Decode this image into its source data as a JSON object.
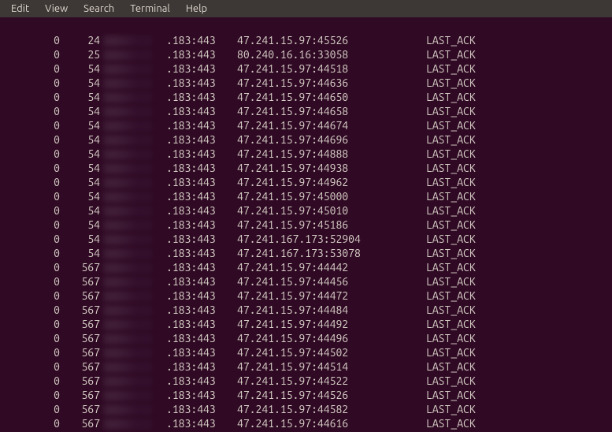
{
  "menubar": {
    "items": [
      "Edit",
      "View",
      "Search",
      "Terminal",
      "Help"
    ]
  },
  "terminal": {
    "rows": [
      {
        "c1": "0",
        "c2": "24",
        "c4": ".183:443",
        "c5": "47.241.15.97:45526",
        "c7": "LAST_ACK"
      },
      {
        "c1": "0",
        "c2": "25",
        "c4": ".183:443",
        "c5": "80.240.16.16:33058",
        "c7": "LAST_ACK"
      },
      {
        "c1": "0",
        "c2": "54",
        "c4": ".183:443",
        "c5": "47.241.15.97:44518",
        "c7": "LAST_ACK"
      },
      {
        "c1": "0",
        "c2": "54",
        "c4": ".183:443",
        "c5": "47.241.15.97:44636",
        "c7": "LAST_ACK"
      },
      {
        "c1": "0",
        "c2": "54",
        "c4": ".183:443",
        "c5": "47.241.15.97:44650",
        "c7": "LAST_ACK"
      },
      {
        "c1": "0",
        "c2": "54",
        "c4": ".183:443",
        "c5": "47.241.15.97:44658",
        "c7": "LAST_ACK"
      },
      {
        "c1": "0",
        "c2": "54",
        "c4": ".183:443",
        "c5": "47.241.15.97:44674",
        "c7": "LAST_ACK"
      },
      {
        "c1": "0",
        "c2": "54",
        "c4": ".183:443",
        "c5": "47.241.15.97:44696",
        "c7": "LAST_ACK"
      },
      {
        "c1": "0",
        "c2": "54",
        "c4": ".183:443",
        "c5": "47.241.15.97:44888",
        "c7": "LAST_ACK"
      },
      {
        "c1": "0",
        "c2": "54",
        "c4": ".183:443",
        "c5": "47.241.15.97:44938",
        "c7": "LAST_ACK"
      },
      {
        "c1": "0",
        "c2": "54",
        "c4": ".183:443",
        "c5": "47.241.15.97:44962",
        "c7": "LAST_ACK"
      },
      {
        "c1": "0",
        "c2": "54",
        "c4": ".183:443",
        "c5": "47.241.15.97:45000",
        "c7": "LAST_ACK"
      },
      {
        "c1": "0",
        "c2": "54",
        "c4": ".183:443",
        "c5": "47.241.15.97:45010",
        "c7": "LAST_ACK"
      },
      {
        "c1": "0",
        "c2": "54",
        "c4": ".183:443",
        "c5": "47.241.15.97:45186",
        "c7": "LAST_ACK"
      },
      {
        "c1": "0",
        "c2": "54",
        "c4": ".183:443",
        "c5": "47.241.167.173:52904",
        "c7": "LAST_ACK"
      },
      {
        "c1": "0",
        "c2": "54",
        "c4": ".183:443",
        "c5": "47.241.167.173:53078",
        "c7": "LAST_ACK"
      },
      {
        "c1": "0",
        "c2": "567",
        "c4": ".183:443",
        "c5": "47.241.15.97:44442",
        "c7": "LAST_ACK"
      },
      {
        "c1": "0",
        "c2": "567",
        "c4": ".183:443",
        "c5": "47.241.15.97:44456",
        "c7": "LAST_ACK"
      },
      {
        "c1": "0",
        "c2": "567",
        "c4": ".183:443",
        "c5": "47.241.15.97:44472",
        "c7": "LAST_ACK"
      },
      {
        "c1": "0",
        "c2": "567",
        "c4": ".183:443",
        "c5": "47.241.15.97:44484",
        "c7": "LAST_ACK"
      },
      {
        "c1": "0",
        "c2": "567",
        "c4": ".183:443",
        "c5": "47.241.15.97:44492",
        "c7": "LAST_ACK"
      },
      {
        "c1": "0",
        "c2": "567",
        "c4": ".183:443",
        "c5": "47.241.15.97:44496",
        "c7": "LAST_ACK"
      },
      {
        "c1": "0",
        "c2": "567",
        "c4": ".183:443",
        "c5": "47.241.15.97:44502",
        "c7": "LAST_ACK"
      },
      {
        "c1": "0",
        "c2": "567",
        "c4": ".183:443",
        "c5": "47.241.15.97:44514",
        "c7": "LAST_ACK"
      },
      {
        "c1": "0",
        "c2": "567",
        "c4": ".183:443",
        "c5": "47.241.15.97:44522",
        "c7": "LAST_ACK"
      },
      {
        "c1": "0",
        "c2": "567",
        "c4": ".183:443",
        "c5": "47.241.15.97:44526",
        "c7": "LAST_ACK"
      },
      {
        "c1": "0",
        "c2": "567",
        "c4": ".183:443",
        "c5": "47.241.15.97:44582",
        "c7": "LAST_ACK"
      },
      {
        "c1": "0",
        "c2": "567",
        "c4": ".183:443",
        "c5": "47.241.15.97:44616",
        "c7": "LAST_ACK"
      }
    ]
  }
}
